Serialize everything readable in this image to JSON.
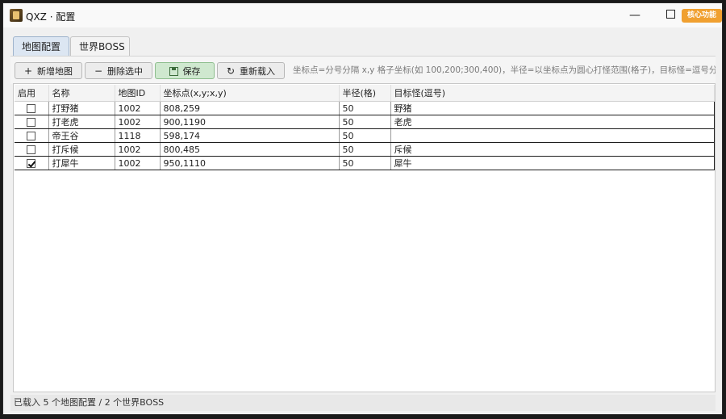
{
  "window": {
    "title": "QXZ · 配置",
    "core_button": "核心功能",
    "minimize_glyph": "—"
  },
  "tabs": [
    {
      "label": "地图配置",
      "active": true
    },
    {
      "label": "世界BOSS",
      "active": false
    }
  ],
  "toolbar": {
    "add_label": "新增地图",
    "delete_label": "删除选中",
    "save_label": "保存",
    "reload_label": "重新载入",
    "add_icon": "plus-icon",
    "delete_icon": "minus-icon",
    "save_icon": "floppy-icon",
    "reload_icon": "refresh-icon"
  },
  "hint": "坐标点=分号分隔 x,y 格子坐标(如 100,200;300,400)，半径=以坐标点为圆心打怪范围(格子)，目标怪=逗号分隔怪名(空",
  "table": {
    "columns": [
      "启用",
      "名称",
      "地图ID",
      "坐标点(x,y;x,y)",
      "半径(格)",
      "目标怪(逗号)"
    ],
    "rows": [
      {
        "enabled": false,
        "name": "打野猪",
        "map_id": "1002",
        "points": "808,259",
        "radius": "50",
        "targets": "野猪"
      },
      {
        "enabled": false,
        "name": "打老虎",
        "map_id": "1002",
        "points": "900,1190",
        "radius": "50",
        "targets": "老虎"
      },
      {
        "enabled": false,
        "name": "帝王谷",
        "map_id": "1118",
        "points": "598,174",
        "radius": "50",
        "targets": ""
      },
      {
        "enabled": false,
        "name": "打斥候",
        "map_id": "1002",
        "points": "800,485",
        "radius": "50",
        "targets": "斥候"
      },
      {
        "enabled": true,
        "name": "打犀牛",
        "map_id": "1002",
        "points": "950,1110",
        "radius": "50",
        "targets": "犀牛"
      }
    ]
  },
  "status": "已载入 5 个地图配置 / 2 个世界BOSS",
  "colors": {
    "accent_core": "#f0a030",
    "save_button": "#cfe8cf",
    "active_tab": "#dce6f2"
  }
}
